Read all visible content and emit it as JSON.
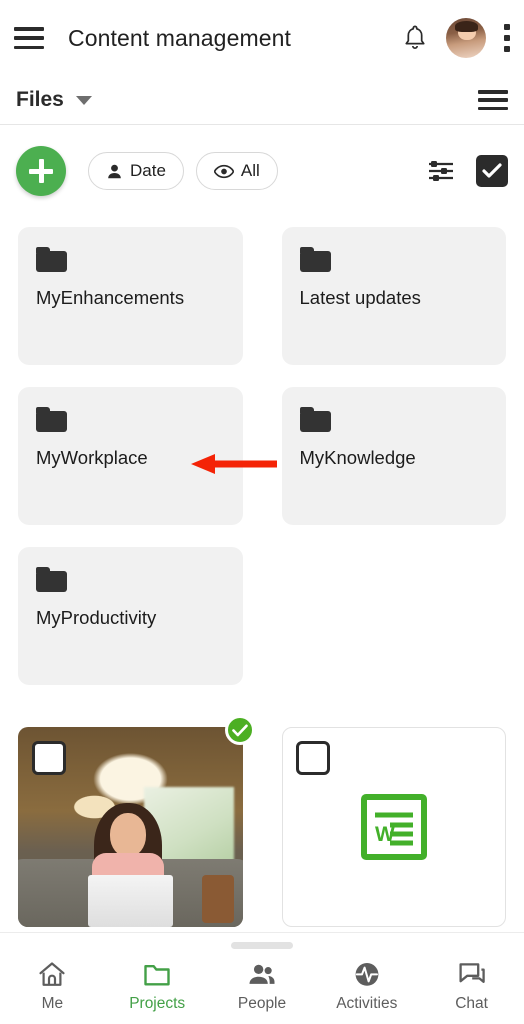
{
  "appbar": {
    "menu_icon": "hamburger-menu-icon",
    "title": "Content management",
    "notification_icon": "bell-icon",
    "avatar_label": "user-avatar",
    "overflow_icon": "kebab-menu-icon"
  },
  "filesbar": {
    "label": "Files",
    "dropdown_icon": "chevron-down-icon",
    "list_icon": "list-view-icon"
  },
  "toolbar": {
    "add_label": "+",
    "add_icon": "plus-icon",
    "chips": [
      {
        "label": "Date",
        "icon": "person-icon"
      },
      {
        "label": "All",
        "icon": "eye-icon"
      }
    ],
    "tune_icon": "tune-sliders-icon",
    "select_all_icon": "checkbox-checked-icon"
  },
  "folders": [
    {
      "name": "MyEnhancements",
      "icon": "folder-icon"
    },
    {
      "name": "Latest updates",
      "icon": "folder-icon"
    },
    {
      "name": "MyWorkplace",
      "icon": "folder-icon"
    },
    {
      "name": "MyKnowledge",
      "icon": "folder-icon"
    },
    {
      "name": "MyProductivity",
      "icon": "folder-icon"
    }
  ],
  "files": [
    {
      "type": "image",
      "selected": true,
      "checkbox_icon": "checkbox-unchecked-icon",
      "badge_icon": "check-circle-icon"
    },
    {
      "type": "document",
      "selected": false,
      "checkbox_icon": "checkbox-unchecked-icon",
      "file_icon": "word-document-icon"
    }
  ],
  "annotation": {
    "type": "arrow-left",
    "color": "#F42306",
    "points_to": "MyWorkplace"
  },
  "bottom_nav": {
    "drag_handle": "drag-handle",
    "items": [
      {
        "label": "Me",
        "icon": "home-icon",
        "active": false
      },
      {
        "label": "Projects",
        "icon": "folder-icon",
        "active": true
      },
      {
        "label": "People",
        "icon": "people-icon",
        "active": false
      },
      {
        "label": "Activities",
        "icon": "activity-pulse-icon",
        "active": false
      },
      {
        "label": "Chat",
        "icon": "chat-bubbles-icon",
        "active": false
      }
    ]
  },
  "colors": {
    "accent_green": "#4CAF50",
    "badge_green": "#4CAF23",
    "word_green": "#43B02A",
    "card_gray": "#F1F1F1",
    "arrow_red": "#F42306",
    "text_dark": "#1C1C1C"
  }
}
